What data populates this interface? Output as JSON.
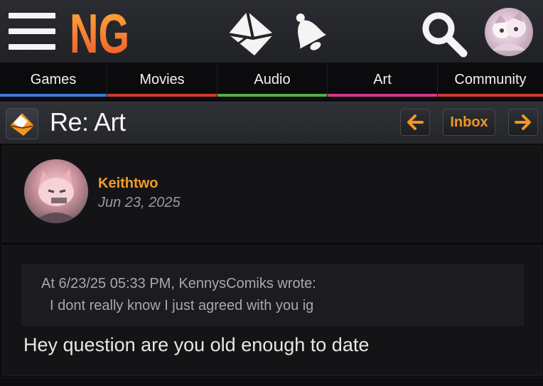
{
  "header": {
    "logo_text": "NG",
    "nav": [
      {
        "label": "Games",
        "color": "#3a7bd5"
      },
      {
        "label": "Movies",
        "color": "#d33a2f"
      },
      {
        "label": "Audio",
        "color": "#52b043"
      },
      {
        "label": "Art",
        "color": "#d8358e"
      },
      {
        "label": "Community",
        "color": "#d33a2f"
      }
    ]
  },
  "titlebar": {
    "title": "Re: Art",
    "inbox_label": "Inbox",
    "accent": "#f29524"
  },
  "post": {
    "username": "Keithtwo",
    "date": "Jun 23, 2025",
    "quote_header": "At 6/23/25 05:33 PM, KennysComiks wrote:",
    "quote_text": "I dont really know I just agreed with you ig",
    "message": "Hey question are you old enough to date"
  }
}
